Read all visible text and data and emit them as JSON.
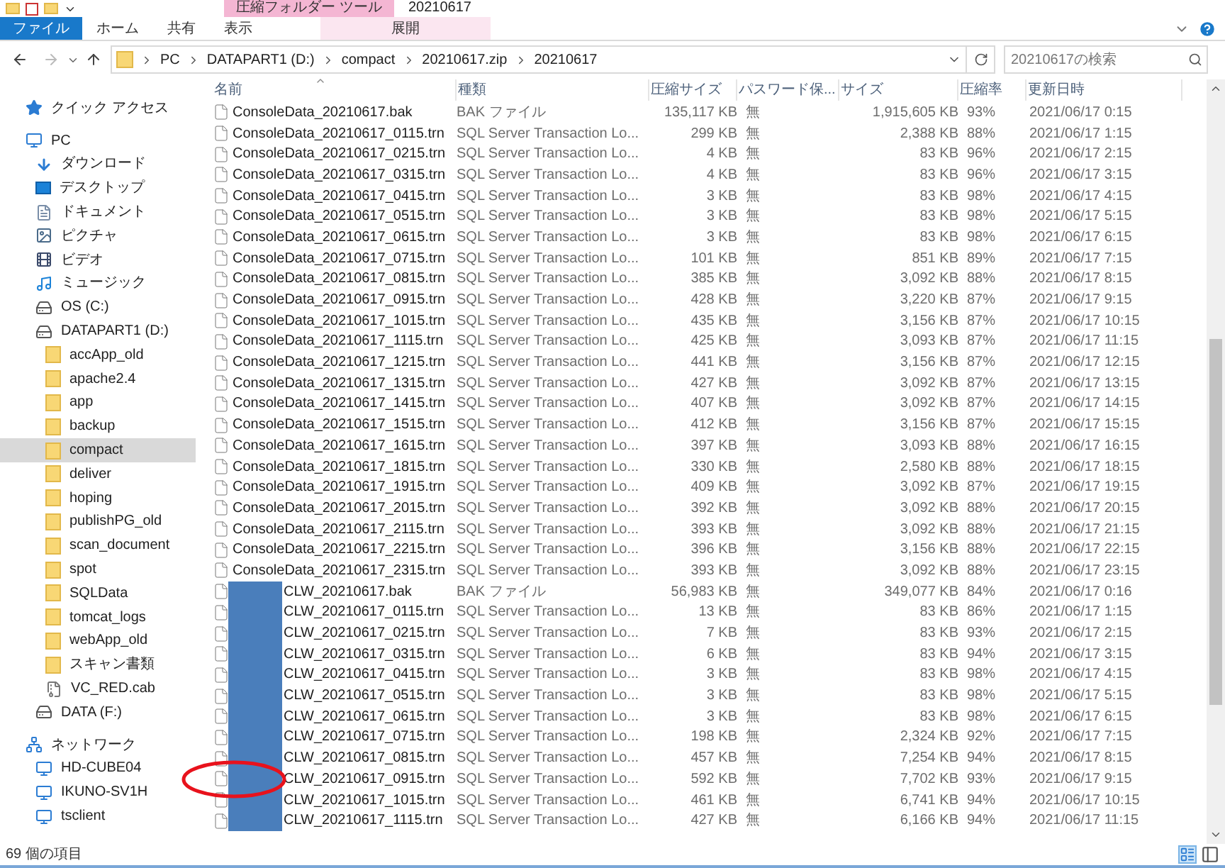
{
  "window": {
    "title": "20210617",
    "context_tab": "圧縮フォルダー ツール"
  },
  "ribbon_tabs": [
    {
      "label": "ファイル",
      "kind": "file"
    },
    {
      "label": "ホーム",
      "kind": "tab"
    },
    {
      "label": "共有",
      "kind": "tab"
    },
    {
      "label": "表示",
      "kind": "tab"
    },
    {
      "label": "展開",
      "kind": "context"
    }
  ],
  "address_bar": {
    "path": [
      "PC",
      "DATAPART1 (D:)",
      "compact",
      "20210617.zip",
      "20210617"
    ]
  },
  "search": {
    "placeholder": "20210617の検索"
  },
  "sidebar": {
    "items": [
      {
        "label": "クイック アクセス",
        "kind": "star",
        "selected": false
      },
      {
        "label": "PC",
        "kind": "pc",
        "selected": false,
        "children": [
          {
            "label": "ダウンロード",
            "kind": "download",
            "selected": false
          },
          {
            "label": "デスクトップ",
            "kind": "desktop",
            "selected": false
          },
          {
            "label": "ドキュメント",
            "kind": "document",
            "selected": false
          },
          {
            "label": "ピクチャ",
            "kind": "picture",
            "selected": false
          },
          {
            "label": "ビデオ",
            "kind": "video",
            "selected": false
          },
          {
            "label": "ミュージック",
            "kind": "music",
            "selected": false
          },
          {
            "label": "OS (C:)",
            "kind": "drive",
            "selected": false
          },
          {
            "label": "DATAPART1 (D:)",
            "kind": "drive",
            "selected": false,
            "children": [
              {
                "label": "accApp_old",
                "kind": "folder",
                "selected": false
              },
              {
                "label": "apache2.4",
                "kind": "folder",
                "selected": false
              },
              {
                "label": "app",
                "kind": "folder",
                "selected": false
              },
              {
                "label": "backup",
                "kind": "folder",
                "selected": false
              },
              {
                "label": "compact",
                "kind": "folder",
                "selected": true
              },
              {
                "label": "deliver",
                "kind": "folder",
                "selected": false
              },
              {
                "label": "hoping",
                "kind": "folder",
                "selected": false
              },
              {
                "label": "publishPG_old",
                "kind": "folder",
                "selected": false
              },
              {
                "label": "scan_document",
                "kind": "folder",
                "selected": false
              },
              {
                "label": "spot",
                "kind": "folder",
                "selected": false
              },
              {
                "label": "SQLData",
                "kind": "folder",
                "selected": false
              },
              {
                "label": "tomcat_logs",
                "kind": "folder",
                "selected": false
              },
              {
                "label": "webApp_old",
                "kind": "folder",
                "selected": false
              },
              {
                "label": "スキャン書類",
                "kind": "folder",
                "selected": false
              },
              {
                "label": "VC_RED.cab",
                "kind": "archive",
                "selected": false
              }
            ]
          },
          {
            "label": "DATA (F:)",
            "kind": "drive",
            "selected": false
          }
        ]
      },
      {
        "label": "ネットワーク",
        "kind": "network",
        "selected": false,
        "children": [
          {
            "label": "HD-CUBE04",
            "kind": "computer",
            "selected": false
          },
          {
            "label": "IKUNO-SV1H",
            "kind": "computer",
            "selected": false
          },
          {
            "label": "tsclient",
            "kind": "computer",
            "selected": false
          }
        ]
      }
    ]
  },
  "table": {
    "columns": [
      "名前",
      "種類",
      "圧縮サイズ",
      "パスワード保...",
      "サイズ",
      "圧縮率",
      "更新日時"
    ],
    "rows": [
      {
        "name": "ConsoleData_20210617.bak",
        "type": "BAK ファイル",
        "compressed_size": "135,117 KB",
        "password": "無",
        "size": "1,915,605 KB",
        "ratio": "93%",
        "modified": "2021/06/17 0:15",
        "redacted": false,
        "circled": false
      },
      {
        "name": "ConsoleData_20210617_0115.trn",
        "type": "SQL Server Transaction Lo...",
        "compressed_size": "299 KB",
        "password": "無",
        "size": "2,388 KB",
        "ratio": "88%",
        "modified": "2021/06/17 1:15",
        "redacted": false,
        "circled": false
      },
      {
        "name": "ConsoleData_20210617_0215.trn",
        "type": "SQL Server Transaction Lo...",
        "compressed_size": "4 KB",
        "password": "無",
        "size": "83 KB",
        "ratio": "96%",
        "modified": "2021/06/17 2:15",
        "redacted": false,
        "circled": false
      },
      {
        "name": "ConsoleData_20210617_0315.trn",
        "type": "SQL Server Transaction Lo...",
        "compressed_size": "4 KB",
        "password": "無",
        "size": "83 KB",
        "ratio": "96%",
        "modified": "2021/06/17 3:15",
        "redacted": false,
        "circled": false
      },
      {
        "name": "ConsoleData_20210617_0415.trn",
        "type": "SQL Server Transaction Lo...",
        "compressed_size": "3 KB",
        "password": "無",
        "size": "83 KB",
        "ratio": "98%",
        "modified": "2021/06/17 4:15",
        "redacted": false,
        "circled": false
      },
      {
        "name": "ConsoleData_20210617_0515.trn",
        "type": "SQL Server Transaction Lo...",
        "compressed_size": "3 KB",
        "password": "無",
        "size": "83 KB",
        "ratio": "98%",
        "modified": "2021/06/17 5:15",
        "redacted": false,
        "circled": false
      },
      {
        "name": "ConsoleData_20210617_0615.trn",
        "type": "SQL Server Transaction Lo...",
        "compressed_size": "3 KB",
        "password": "無",
        "size": "83 KB",
        "ratio": "98%",
        "modified": "2021/06/17 6:15",
        "redacted": false,
        "circled": false
      },
      {
        "name": "ConsoleData_20210617_0715.trn",
        "type": "SQL Server Transaction Lo...",
        "compressed_size": "101 KB",
        "password": "無",
        "size": "851 KB",
        "ratio": "89%",
        "modified": "2021/06/17 7:15",
        "redacted": false,
        "circled": false
      },
      {
        "name": "ConsoleData_20210617_0815.trn",
        "type": "SQL Server Transaction Lo...",
        "compressed_size": "385 KB",
        "password": "無",
        "size": "3,092 KB",
        "ratio": "88%",
        "modified": "2021/06/17 8:15",
        "redacted": false,
        "circled": false
      },
      {
        "name": "ConsoleData_20210617_0915.trn",
        "type": "SQL Server Transaction Lo...",
        "compressed_size": "428 KB",
        "password": "無",
        "size": "3,220 KB",
        "ratio": "87%",
        "modified": "2021/06/17 9:15",
        "redacted": false,
        "circled": false
      },
      {
        "name": "ConsoleData_20210617_1015.trn",
        "type": "SQL Server Transaction Lo...",
        "compressed_size": "435 KB",
        "password": "無",
        "size": "3,156 KB",
        "ratio": "87%",
        "modified": "2021/06/17 10:15",
        "redacted": false,
        "circled": false
      },
      {
        "name": "ConsoleData_20210617_1115.trn",
        "type": "SQL Server Transaction Lo...",
        "compressed_size": "425 KB",
        "password": "無",
        "size": "3,093 KB",
        "ratio": "87%",
        "modified": "2021/06/17 11:15",
        "redacted": false,
        "circled": false
      },
      {
        "name": "ConsoleData_20210617_1215.trn",
        "type": "SQL Server Transaction Lo...",
        "compressed_size": "441 KB",
        "password": "無",
        "size": "3,156 KB",
        "ratio": "87%",
        "modified": "2021/06/17 12:15",
        "redacted": false,
        "circled": false
      },
      {
        "name": "ConsoleData_20210617_1315.trn",
        "type": "SQL Server Transaction Lo...",
        "compressed_size": "427 KB",
        "password": "無",
        "size": "3,092 KB",
        "ratio": "87%",
        "modified": "2021/06/17 13:15",
        "redacted": false,
        "circled": false
      },
      {
        "name": "ConsoleData_20210617_1415.trn",
        "type": "SQL Server Transaction Lo...",
        "compressed_size": "407 KB",
        "password": "無",
        "size": "3,092 KB",
        "ratio": "87%",
        "modified": "2021/06/17 14:15",
        "redacted": false,
        "circled": false
      },
      {
        "name": "ConsoleData_20210617_1515.trn",
        "type": "SQL Server Transaction Lo...",
        "compressed_size": "412 KB",
        "password": "無",
        "size": "3,156 KB",
        "ratio": "87%",
        "modified": "2021/06/17 15:15",
        "redacted": false,
        "circled": false
      },
      {
        "name": "ConsoleData_20210617_1615.trn",
        "type": "SQL Server Transaction Lo...",
        "compressed_size": "397 KB",
        "password": "無",
        "size": "3,093 KB",
        "ratio": "88%",
        "modified": "2021/06/17 16:15",
        "redacted": false,
        "circled": false
      },
      {
        "name": "ConsoleData_20210617_1815.trn",
        "type": "SQL Server Transaction Lo...",
        "compressed_size": "330 KB",
        "password": "無",
        "size": "2,580 KB",
        "ratio": "88%",
        "modified": "2021/06/17 18:15",
        "redacted": false,
        "circled": false
      },
      {
        "name": "ConsoleData_20210617_1915.trn",
        "type": "SQL Server Transaction Lo...",
        "compressed_size": "409 KB",
        "password": "無",
        "size": "3,092 KB",
        "ratio": "87%",
        "modified": "2021/06/17 19:15",
        "redacted": false,
        "circled": false
      },
      {
        "name": "ConsoleData_20210617_2015.trn",
        "type": "SQL Server Transaction Lo...",
        "compressed_size": "392 KB",
        "password": "無",
        "size": "3,092 KB",
        "ratio": "88%",
        "modified": "2021/06/17 20:15",
        "redacted": false,
        "circled": false
      },
      {
        "name": "ConsoleData_20210617_2115.trn",
        "type": "SQL Server Transaction Lo...",
        "compressed_size": "393 KB",
        "password": "無",
        "size": "3,092 KB",
        "ratio": "88%",
        "modified": "2021/06/17 21:15",
        "redacted": false,
        "circled": false
      },
      {
        "name": "ConsoleData_20210617_2215.trn",
        "type": "SQL Server Transaction Lo...",
        "compressed_size": "396 KB",
        "password": "無",
        "size": "3,156 KB",
        "ratio": "88%",
        "modified": "2021/06/17 22:15",
        "redacted": false,
        "circled": false
      },
      {
        "name": "ConsoleData_20210617_2315.trn",
        "type": "SQL Server Transaction Lo...",
        "compressed_size": "393 KB",
        "password": "無",
        "size": "3,092 KB",
        "ratio": "88%",
        "modified": "2021/06/17 23:15",
        "redacted": false,
        "circled": false
      },
      {
        "name": "CLW_20210617.bak",
        "type": "BAK ファイル",
        "compressed_size": "56,983 KB",
        "password": "無",
        "size": "349,077 KB",
        "ratio": "84%",
        "modified": "2021/06/17 0:16",
        "redacted": true,
        "circled": false
      },
      {
        "name": "CLW_20210617_0115.trn",
        "type": "SQL Server Transaction Lo...",
        "compressed_size": "13 KB",
        "password": "無",
        "size": "83 KB",
        "ratio": "86%",
        "modified": "2021/06/17 1:15",
        "redacted": true,
        "circled": false
      },
      {
        "name": "CLW_20210617_0215.trn",
        "type": "SQL Server Transaction Lo...",
        "compressed_size": "7 KB",
        "password": "無",
        "size": "83 KB",
        "ratio": "93%",
        "modified": "2021/06/17 2:15",
        "redacted": true,
        "circled": false
      },
      {
        "name": "CLW_20210617_0315.trn",
        "type": "SQL Server Transaction Lo...",
        "compressed_size": "6 KB",
        "password": "無",
        "size": "83 KB",
        "ratio": "94%",
        "modified": "2021/06/17 3:15",
        "redacted": true,
        "circled": false
      },
      {
        "name": "CLW_20210617_0415.trn",
        "type": "SQL Server Transaction Lo...",
        "compressed_size": "3 KB",
        "password": "無",
        "size": "83 KB",
        "ratio": "98%",
        "modified": "2021/06/17 4:15",
        "redacted": true,
        "circled": false
      },
      {
        "name": "CLW_20210617_0515.trn",
        "type": "SQL Server Transaction Lo...",
        "compressed_size": "3 KB",
        "password": "無",
        "size": "83 KB",
        "ratio": "98%",
        "modified": "2021/06/17 5:15",
        "redacted": true,
        "circled": false
      },
      {
        "name": "CLW_20210617_0615.trn",
        "type": "SQL Server Transaction Lo...",
        "compressed_size": "3 KB",
        "password": "無",
        "size": "83 KB",
        "ratio": "98%",
        "modified": "2021/06/17 6:15",
        "redacted": true,
        "circled": false
      },
      {
        "name": "CLW_20210617_0715.trn",
        "type": "SQL Server Transaction Lo...",
        "compressed_size": "198 KB",
        "password": "無",
        "size": "2,324 KB",
        "ratio": "92%",
        "modified": "2021/06/17 7:15",
        "redacted": true,
        "circled": false
      },
      {
        "name": "CLW_20210617_0815.trn",
        "type": "SQL Server Transaction Lo...",
        "compressed_size": "457 KB",
        "password": "無",
        "size": "7,254 KB",
        "ratio": "94%",
        "modified": "2021/06/17 8:15",
        "redacted": true,
        "circled": false
      },
      {
        "name": "CLW_20210617_0915.trn",
        "type": "SQL Server Transaction Lo...",
        "compressed_size": "592 KB",
        "password": "無",
        "size": "7,702 KB",
        "ratio": "93%",
        "modified": "2021/06/17 9:15",
        "redacted": true,
        "circled": true
      },
      {
        "name": "CLW_20210617_1015.trn",
        "type": "SQL Server Transaction Lo...",
        "compressed_size": "461 KB",
        "password": "無",
        "size": "6,741 KB",
        "ratio": "94%",
        "modified": "2021/06/17 10:15",
        "redacted": true,
        "circled": false
      },
      {
        "name": "CLW_20210617_1115.trn",
        "type": "SQL Server Transaction Lo...",
        "compressed_size": "427 KB",
        "password": "無",
        "size": "6,166 KB",
        "ratio": "94%",
        "modified": "2021/06/17 11:15",
        "redacted": true,
        "circled": false
      }
    ]
  },
  "status_bar": {
    "item_count": "69 個の項目"
  }
}
